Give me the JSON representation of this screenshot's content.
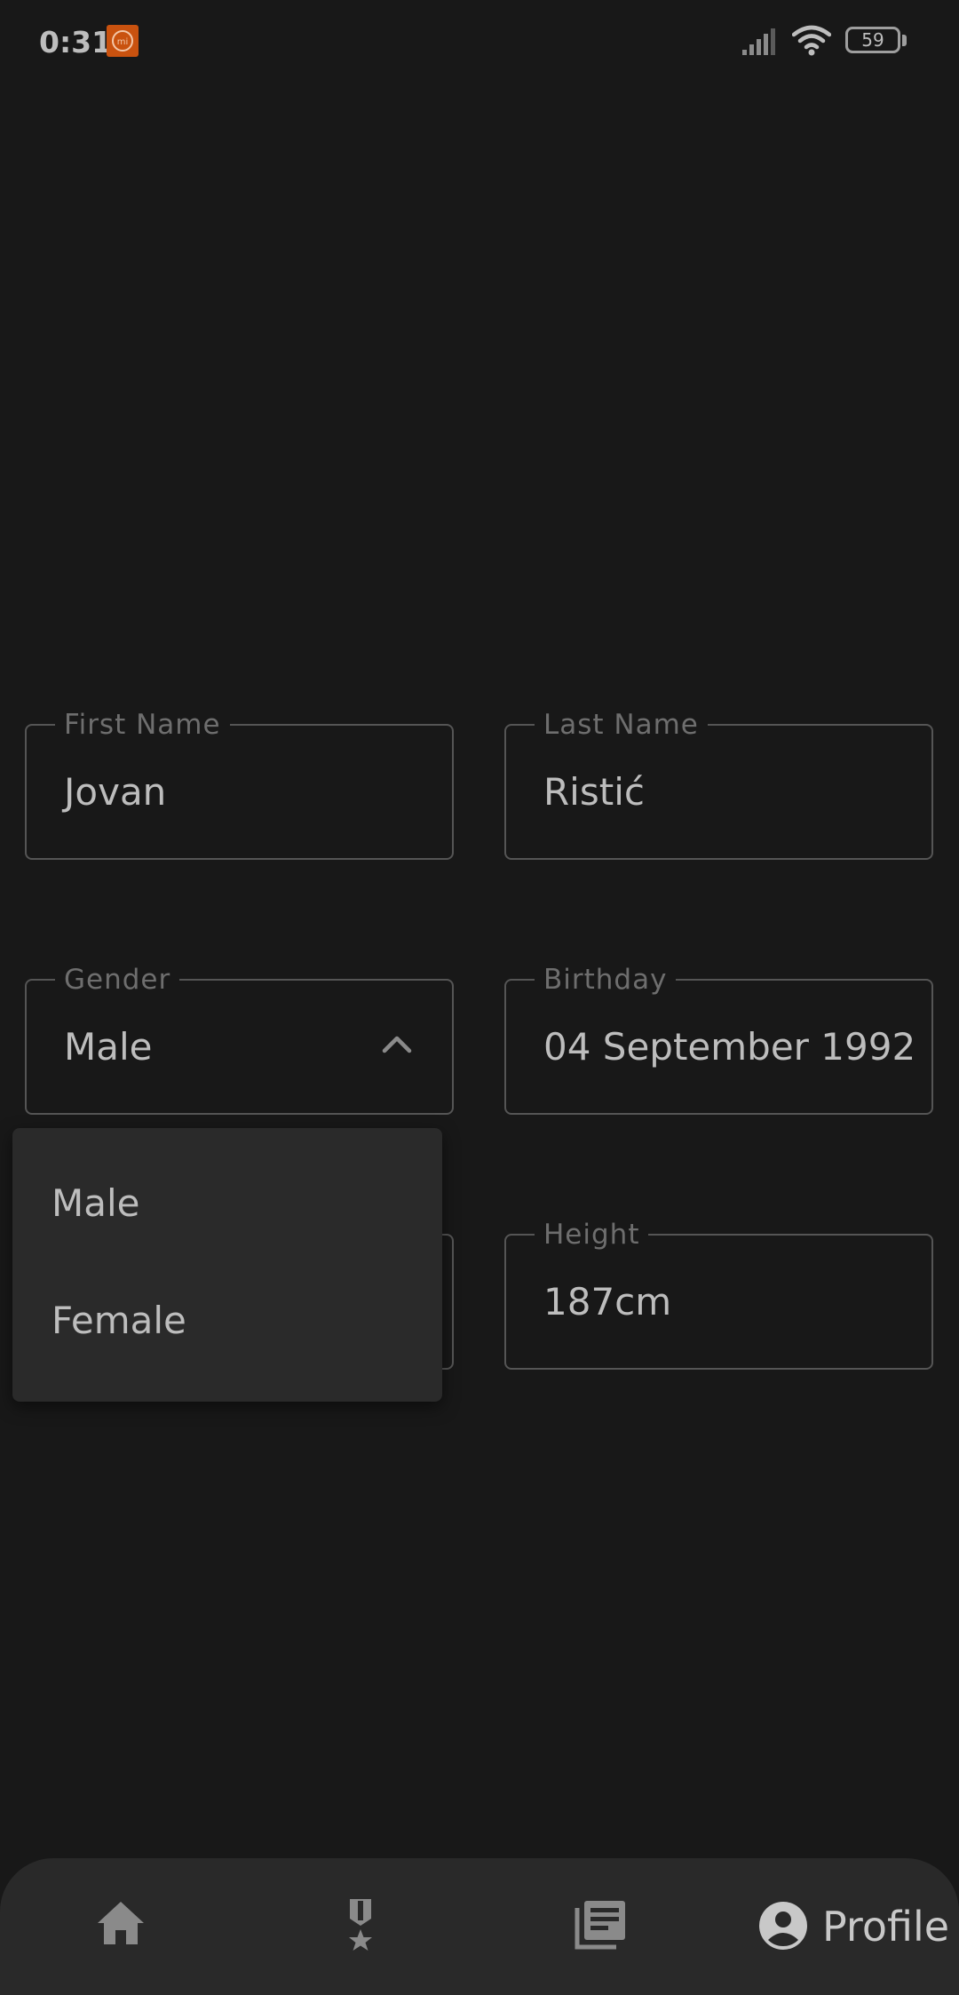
{
  "status_bar": {
    "time": "0:31",
    "battery_level": "59"
  },
  "form": {
    "first_name": {
      "label": "First Name",
      "value": "Jovan"
    },
    "last_name": {
      "label": "Last Name",
      "value": "Ristić"
    },
    "gender": {
      "label": "Gender",
      "value": "Male"
    },
    "birthday": {
      "label": "Birthday",
      "value": "04 September 1992"
    },
    "height": {
      "label": "Height",
      "value": "187cm"
    }
  },
  "gender_dropdown": {
    "options": [
      "Male",
      "Female"
    ]
  },
  "bottom_nav": {
    "items": [
      {
        "icon": "home-icon"
      },
      {
        "icon": "medal-icon"
      },
      {
        "icon": "news-icon"
      },
      {
        "icon": "account-circle-icon",
        "label": "Profile"
      }
    ]
  },
  "colors": {
    "background": "#181818",
    "surface": "#2a2a2a",
    "nav_background": "#292929",
    "field_border": "#555555",
    "text": "#bdbdbd",
    "label_text": "#6e6e6e",
    "notification_accent": "#c9520f"
  }
}
